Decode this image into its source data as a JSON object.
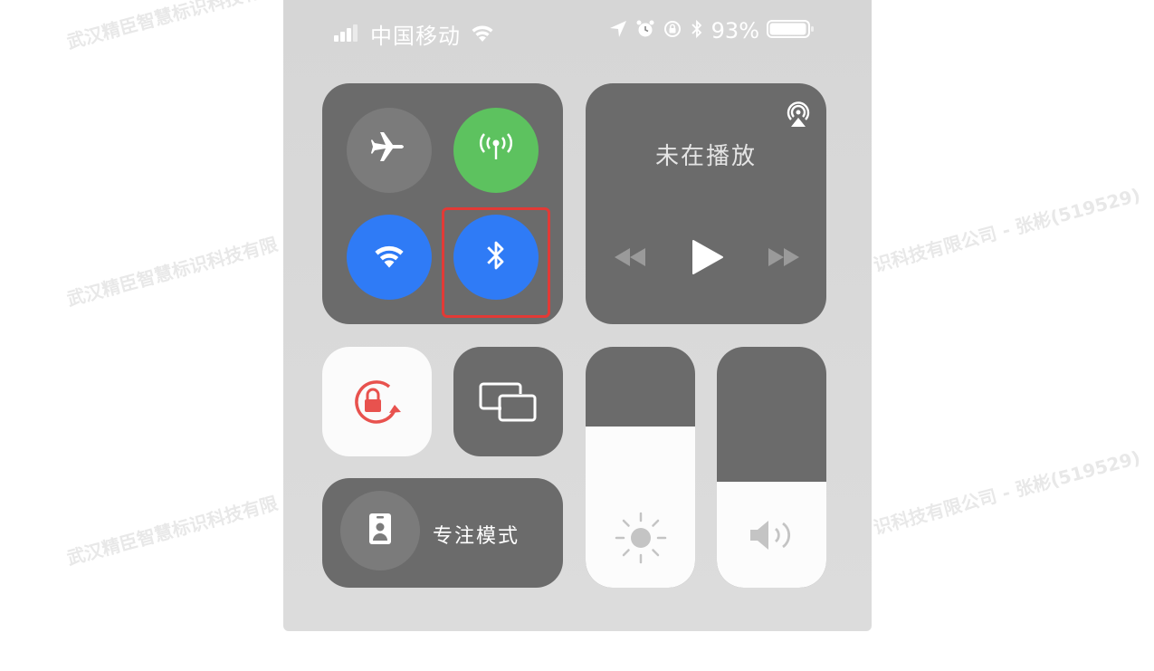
{
  "status_bar": {
    "carrier": "中国移动",
    "battery_percent": "93%",
    "signal_icon": "cellular-signal-icon",
    "wifi_icon": "wifi-icon",
    "icons_right": [
      "location-arrow-icon",
      "alarm-icon",
      "orientation-lock-icon",
      "bluetooth-icon"
    ],
    "battery_level": 0.93
  },
  "connectivity": {
    "airplane": {
      "icon": "airplane-icon",
      "active": false
    },
    "cellular": {
      "icon": "cellular-data-icon",
      "active": true,
      "color": "#5dc25f"
    },
    "wifi": {
      "icon": "wifi-icon",
      "active": true,
      "color": "#2f7bf6"
    },
    "bluetooth": {
      "icon": "bluetooth-icon",
      "active": true,
      "color": "#2f7bf6",
      "highlighted": true,
      "highlight_color": "#e23a36"
    }
  },
  "now_playing": {
    "title": "未在播放",
    "airplay_icon": "airplay-icon",
    "controls": [
      "rewind-icon",
      "play-icon",
      "fast-forward-icon"
    ]
  },
  "orientation_lock": {
    "icon": "orientation-lock-icon",
    "active": true,
    "color": "#e8524e"
  },
  "screen_mirroring": {
    "icon": "screen-mirroring-icon"
  },
  "focus": {
    "label": "专注模式",
    "icon": "focus-person-icon"
  },
  "brightness": {
    "icon": "sun-icon",
    "level": 0.67
  },
  "volume": {
    "icon": "speaker-icon",
    "level": 0.44
  },
  "watermark": {
    "text_left": "武汉精臣智慧标识科技有限",
    "text_right": "识科技有限公司 - 张彬(519529)"
  }
}
